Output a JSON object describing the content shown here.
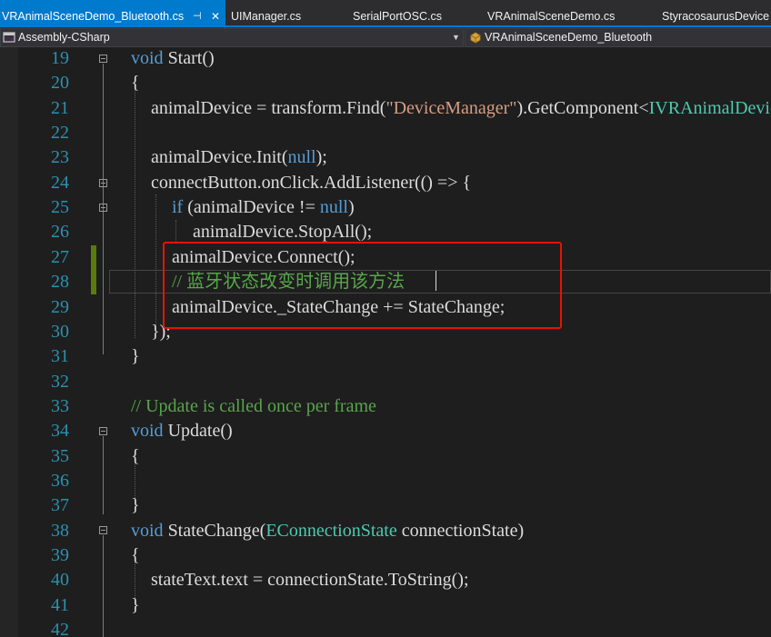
{
  "tabs": [
    {
      "label": "VRAnimalSceneDemo_Bluetooth.cs",
      "active": true
    },
    {
      "label": "UIManager.cs"
    },
    {
      "label": "SerialPortOSC.cs"
    },
    {
      "label": "VRAnimalSceneDemo.cs"
    },
    {
      "label": "StyracosaurusDevice"
    }
  ],
  "nav": {
    "project": "Assembly-CSharp",
    "class": "VRAnimalSceneDemo_Bluetooth"
  },
  "lines": [
    {
      "n": "19",
      "tokens": [
        {
          "t": "void ",
          "c": "kw"
        },
        {
          "t": "Start"
        },
        {
          "t": "()"
        }
      ]
    },
    {
      "n": "20",
      "tokens": [
        {
          "t": "{"
        }
      ]
    },
    {
      "n": "21",
      "tokens": [
        {
          "t": "animalDevice = transform.Find("
        },
        {
          "t": "\"DeviceManager\"",
          "c": "str"
        },
        {
          "t": ").GetComponent<"
        },
        {
          "t": "IVRAnimalDevice",
          "c": "ty"
        }
      ]
    },
    {
      "n": "22",
      "tokens": []
    },
    {
      "n": "23",
      "tokens": [
        {
          "t": "animalDevice.Init("
        },
        {
          "t": "null",
          "c": "kw"
        },
        {
          "t": ");"
        }
      ]
    },
    {
      "n": "24",
      "tokens": [
        {
          "t": "connectButton.onClick.AddListener(() => {"
        }
      ]
    },
    {
      "n": "25",
      "tokens": [
        {
          "t": "if ",
          "c": "kw"
        },
        {
          "t": "(animalDevice != "
        },
        {
          "t": "null",
          "c": "kw"
        },
        {
          "t": ")"
        }
      ]
    },
    {
      "n": "26",
      "tokens": [
        {
          "t": "animalDevice.StopAll();"
        }
      ]
    },
    {
      "n": "27",
      "tokens": [
        {
          "t": "animalDevice.Connect();"
        }
      ]
    },
    {
      "n": "28",
      "tokens": [
        {
          "t": "// 蓝牙状态改变时调用该方法",
          "c": "cm"
        }
      ]
    },
    {
      "n": "29",
      "tokens": [
        {
          "t": "animalDevice._StateChange += StateChange;"
        }
      ]
    },
    {
      "n": "30",
      "tokens": [
        {
          "t": "});"
        }
      ]
    },
    {
      "n": "31",
      "tokens": [
        {
          "t": "}"
        }
      ]
    },
    {
      "n": "32",
      "tokens": []
    },
    {
      "n": "33",
      "tokens": [
        {
          "t": "// Update is called once per frame",
          "c": "cm"
        }
      ]
    },
    {
      "n": "34",
      "tokens": [
        {
          "t": "void ",
          "c": "kw"
        },
        {
          "t": "Update"
        },
        {
          "t": "()"
        }
      ]
    },
    {
      "n": "35",
      "tokens": [
        {
          "t": "{"
        }
      ]
    },
    {
      "n": "36",
      "tokens": []
    },
    {
      "n": "37",
      "tokens": [
        {
          "t": "}"
        }
      ]
    },
    {
      "n": "38",
      "tokens": [
        {
          "t": "void ",
          "c": "kw"
        },
        {
          "t": "StateChange("
        },
        {
          "t": "EConnectionState",
          "c": "ty"
        },
        {
          "t": " connectionState)"
        }
      ]
    },
    {
      "n": "39",
      "tokens": [
        {
          "t": "{"
        }
      ]
    },
    {
      "n": "40",
      "tokens": [
        {
          "t": "stateText.text = connectionState.ToString();"
        }
      ]
    },
    {
      "n": "41",
      "tokens": [
        {
          "t": "}"
        }
      ]
    },
    {
      "n": "42",
      "tokens": []
    }
  ],
  "colors": {
    "keyword": "#569cd6",
    "string": "#d69d85",
    "comment": "#57a64a",
    "type": "#4ec9b0",
    "line_number": "#2b91af",
    "highlight_box": "#e51400",
    "active_tab": "#007acc"
  }
}
